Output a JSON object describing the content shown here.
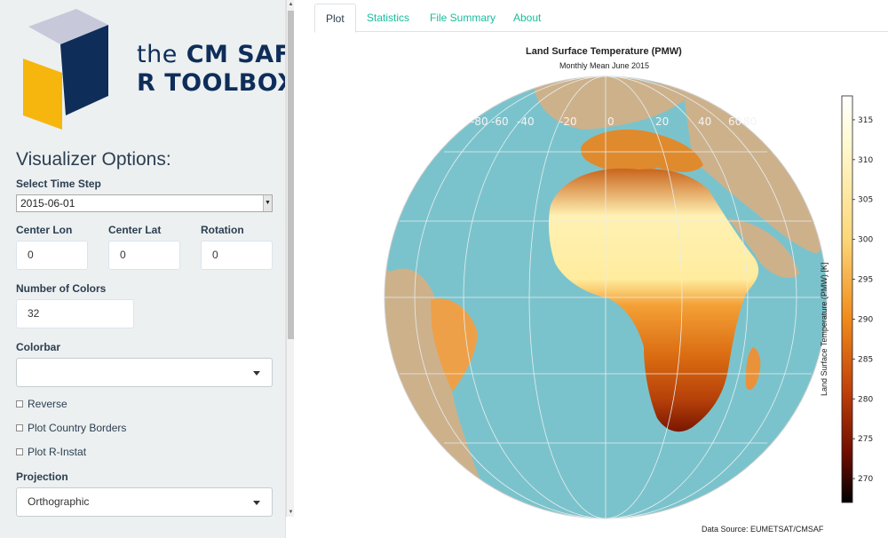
{
  "sidebar": {
    "logo": {
      "line1_a": "the",
      "line1_b": "CM SAF",
      "line2": "R TOOLBOX"
    },
    "title": "Visualizer Options:",
    "time_step": {
      "label": "Select Time Step",
      "value": "2015-06-01"
    },
    "center_lon": {
      "label": "Center Lon",
      "value": "0"
    },
    "center_lat": {
      "label": "Center Lat",
      "value": "0"
    },
    "rotation": {
      "label": "Rotation",
      "value": "0"
    },
    "num_colors": {
      "label": "Number of Colors",
      "value": "32"
    },
    "colorbar": {
      "label": "Colorbar",
      "value": ""
    },
    "checkboxes": [
      {
        "label": "Reverse",
        "checked": false
      },
      {
        "label": "Plot Country Borders",
        "checked": false
      },
      {
        "label": "Plot R-Instat",
        "checked": false
      }
    ],
    "projection": {
      "label": "Projection",
      "value": "Orthographic"
    }
  },
  "tabs": [
    {
      "label": "Plot",
      "active": true
    },
    {
      "label": "Statistics",
      "active": false
    },
    {
      "label": "File Summary",
      "active": false
    },
    {
      "label": "About",
      "active": false
    }
  ],
  "plot": {
    "title": "Land Surface Temperature (PMW)",
    "subtitle": "Monthly Mean June 2015",
    "lon_ticks": [
      "-80",
      "-60",
      "-40",
      "-20",
      "0",
      "20",
      "40",
      "60",
      "80"
    ],
    "colorbar_label": "Land Surface Temperature (PMW) [K]",
    "colorbar_ticks": [
      "315",
      "310",
      "305",
      "300",
      "295",
      "290",
      "285",
      "280",
      "275",
      "270"
    ],
    "colorbar_range": [
      267,
      318
    ],
    "source": "Data Source: EUMETSAT/CMSAF",
    "colors": {
      "ocean": "#7bc3cc",
      "nodata_land": "#cdb18b",
      "hot": "#fff5c0",
      "cold": "#3a0000"
    }
  },
  "theme": {
    "accent": "#18bc9c",
    "navy": "#0f2d59",
    "logo_yellow": "#f6b60e",
    "logo_blue": "#0f2d59",
    "logo_grey": "#c7c9da"
  }
}
